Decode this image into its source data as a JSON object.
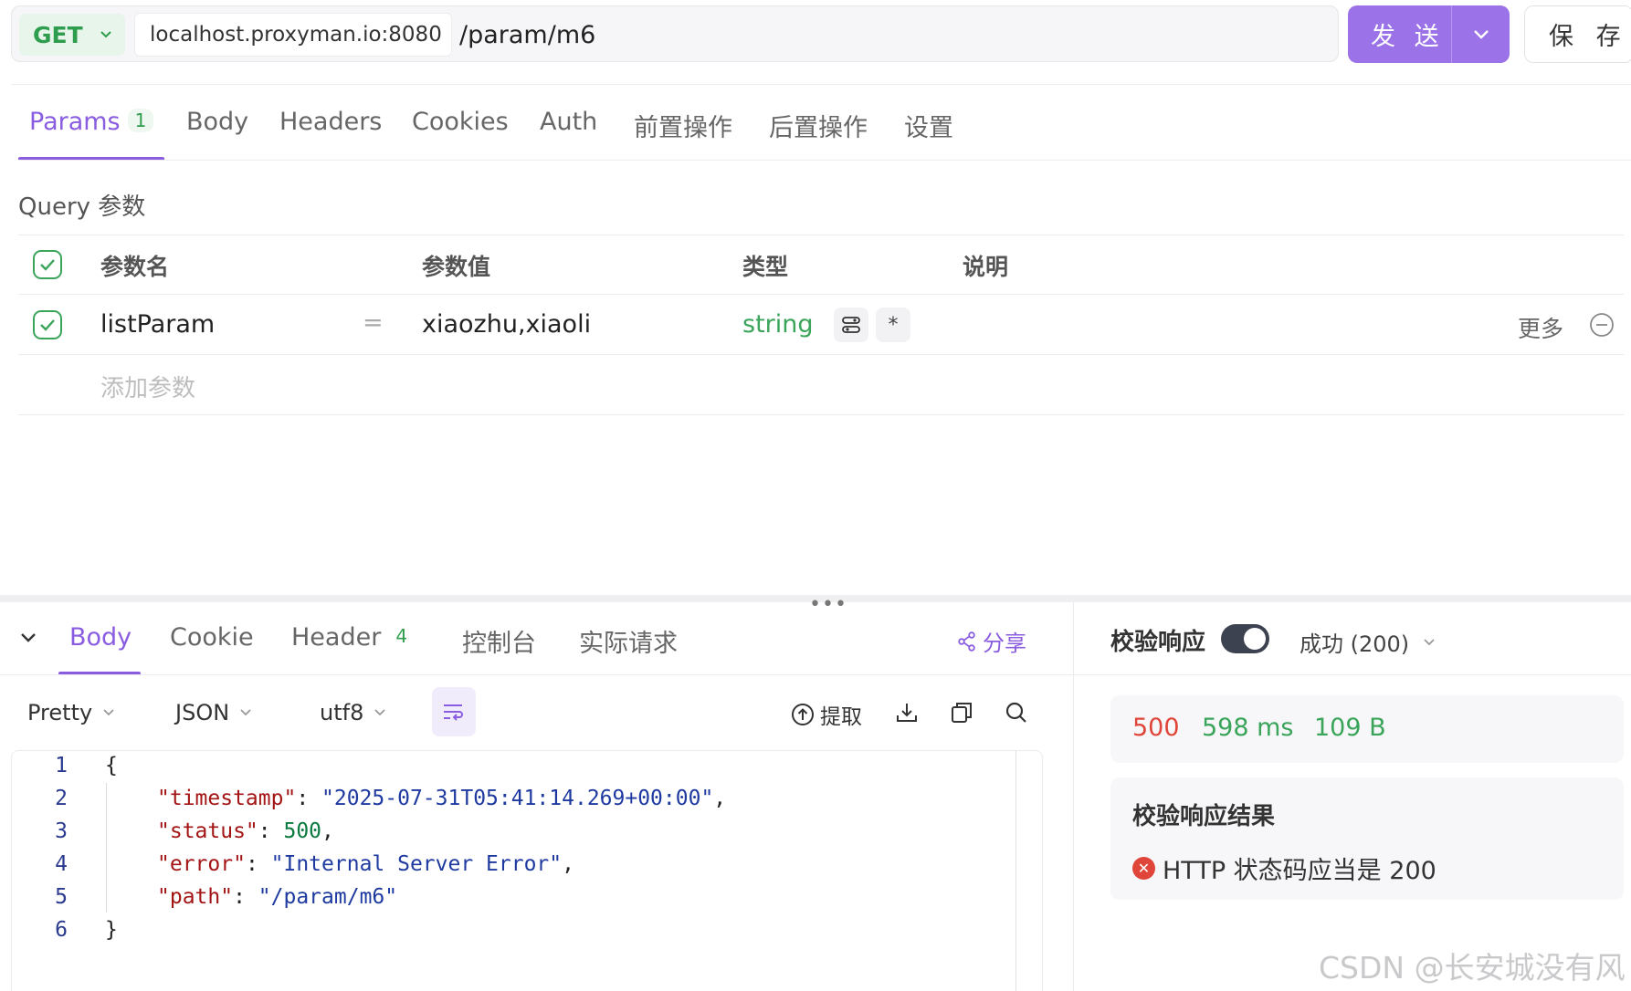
{
  "request": {
    "method": "GET",
    "host": "localhost.proxyman.io:8080",
    "path": "/param/m6",
    "send_label": "发 送",
    "save_label": "保 存"
  },
  "request_tabs": [
    {
      "label": "Params",
      "badge": "1",
      "active": true
    },
    {
      "label": "Body"
    },
    {
      "label": "Headers"
    },
    {
      "label": "Cookies"
    },
    {
      "label": "Auth"
    },
    {
      "label": "前置操作"
    },
    {
      "label": "后置操作"
    },
    {
      "label": "设置"
    }
  ],
  "params": {
    "section_title": "Query 参数",
    "columns": [
      "参数名",
      "参数值",
      "类型",
      "说明"
    ],
    "rows": [
      {
        "name": "listParam",
        "equals": "=",
        "value": "xiaozhu,xiaoli",
        "type": "string",
        "required_mark": "*",
        "more_label": "更多",
        "checked": true
      }
    ],
    "add_placeholder": "添加参数"
  },
  "response_tabs": [
    {
      "label": "Body",
      "active": true
    },
    {
      "label": "Cookie"
    },
    {
      "label": "Header",
      "badge": "4"
    },
    {
      "label": "控制台"
    },
    {
      "label": "实际请求"
    }
  ],
  "share_label": "分享",
  "toolbar": {
    "format": "Pretty",
    "lang": "JSON",
    "encoding": "utf8",
    "extract_label": "提取"
  },
  "code_lines": [
    {
      "num": "1",
      "indent": 0,
      "open": "{"
    },
    {
      "num": "2",
      "indent": 1,
      "key": "\"timestamp\"",
      "value": "\"2025-07-31T05:41:14.269+00:00\"",
      "comma": ","
    },
    {
      "num": "3",
      "indent": 1,
      "key": "\"status\"",
      "value": "500",
      "comma": ","
    },
    {
      "num": "4",
      "indent": 1,
      "key": "\"error\"",
      "value": "\"Internal Server Error\"",
      "comma": ","
    },
    {
      "num": "5",
      "indent": 1,
      "key": "\"path\"",
      "value": "\"/param/m6\"",
      "comma": ""
    },
    {
      "num": "6",
      "indent": 0,
      "open": "}"
    }
  ],
  "validation": {
    "title": "校验响应",
    "toggle_on": true,
    "status_option": "成功 (200)",
    "status_code": "500",
    "duration": "598 ms",
    "size": "109 B",
    "result_title": "校验响应结果",
    "result_item": "HTTP 状态码应当是 200"
  },
  "watermark": "CSDN @长安城没有风",
  "colors": {
    "accent": "#8a5ce0",
    "send_button": "#9b72e8",
    "method_green": "#2e9e4e",
    "error_red": "#e0453a",
    "success_green": "#3aa55a"
  }
}
